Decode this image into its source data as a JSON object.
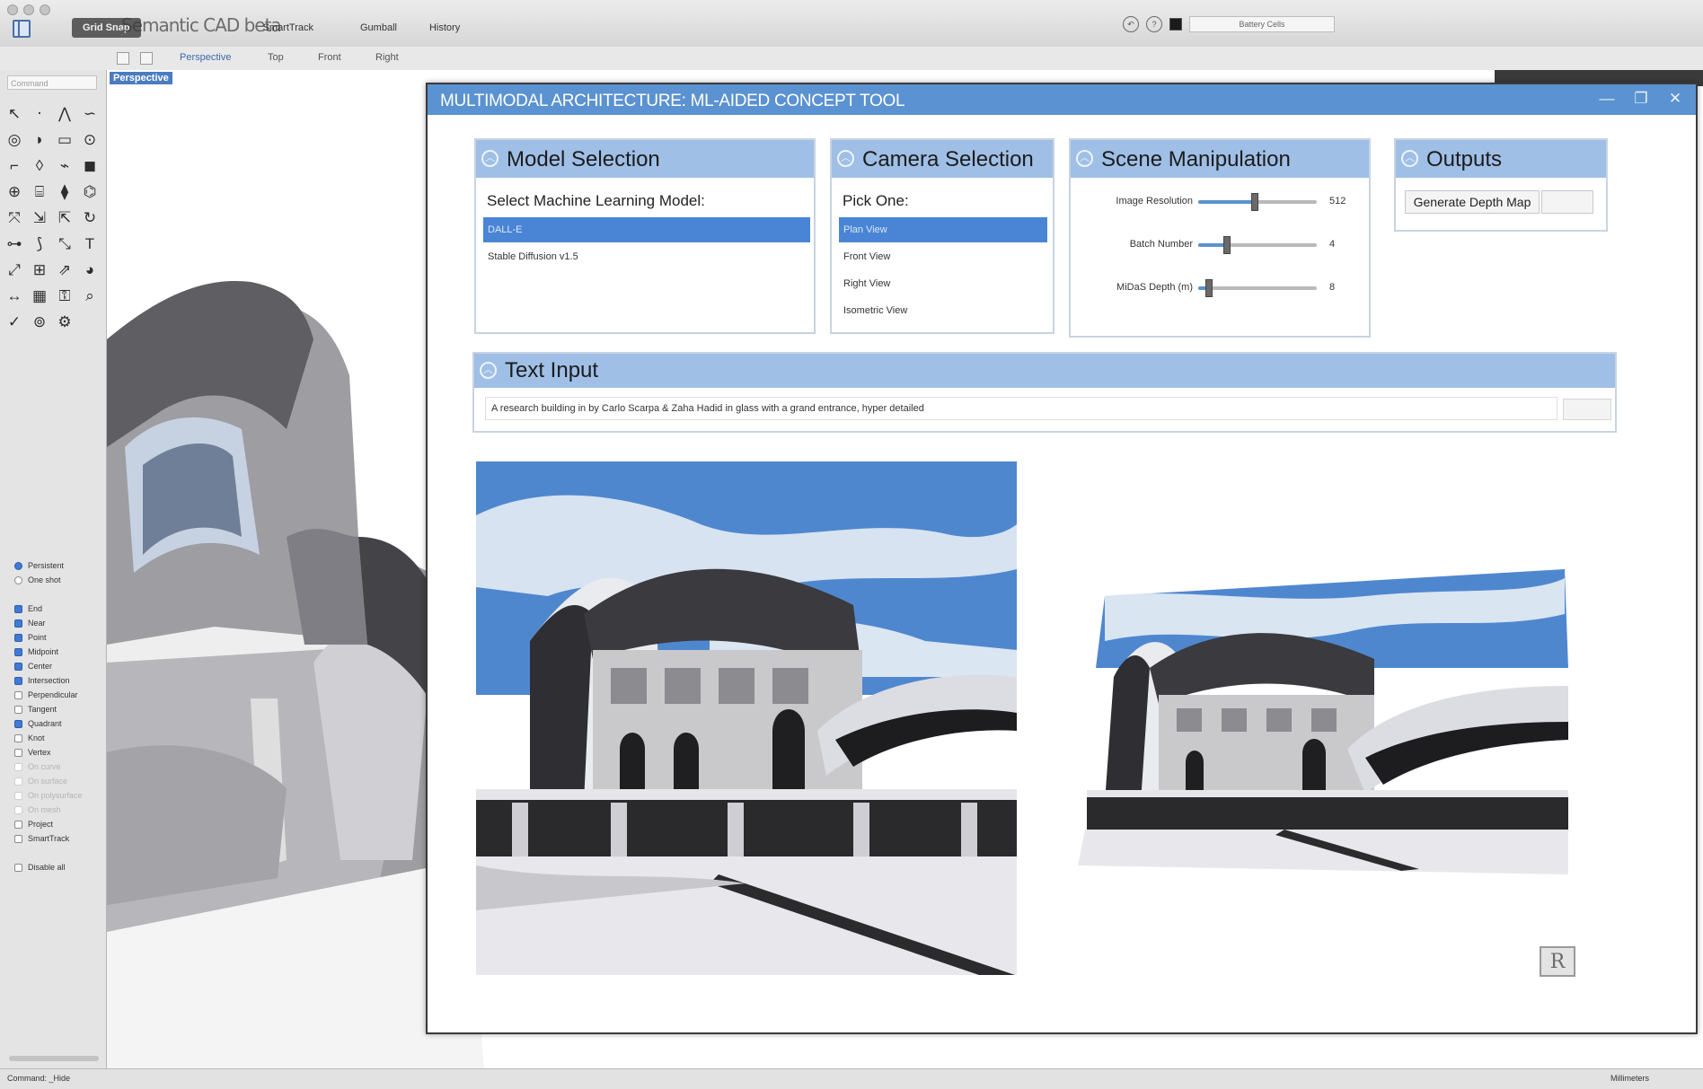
{
  "app": {
    "document_title": "Semantic CAD beta",
    "osnap_tabs": [
      "Grid Snap",
      "SmartTrack",
      "Gumball",
      "History"
    ],
    "layer_field": "Battery Cells",
    "command_placeholder": "Command",
    "viewport_tabs": [
      "Perspective",
      "Top",
      "Front",
      "Right"
    ],
    "active_viewport": "Perspective"
  },
  "osnaps": [
    {
      "label": "Persistent",
      "checked": true,
      "radio": true
    },
    {
      "label": "One shot",
      "checked": false,
      "radio": true
    },
    {
      "label": "",
      "spacer": true
    },
    {
      "label": "End",
      "checked": true
    },
    {
      "label": "Near",
      "checked": true
    },
    {
      "label": "Point",
      "checked": true
    },
    {
      "label": "Midpoint",
      "checked": true
    },
    {
      "label": "Center",
      "checked": true
    },
    {
      "label": "Intersection",
      "checked": true
    },
    {
      "label": "Perpendicular",
      "checked": false
    },
    {
      "label": "Tangent",
      "checked": false
    },
    {
      "label": "Quadrant",
      "checked": true
    },
    {
      "label": "Knot",
      "checked": false
    },
    {
      "label": "Vertex",
      "checked": false
    },
    {
      "label": "On curve",
      "checked": false,
      "dim": true
    },
    {
      "label": "On surface",
      "checked": false,
      "dim": true
    },
    {
      "label": "On polysurface",
      "checked": false,
      "dim": true
    },
    {
      "label": "On mesh",
      "checked": false,
      "dim": true
    },
    {
      "label": "Project",
      "checked": false
    },
    {
      "label": "SmartTrack",
      "checked": false
    },
    {
      "label": "",
      "spacer": true
    },
    {
      "label": "Disable all",
      "checked": false
    }
  ],
  "status": {
    "command_line": "Command: _Hide",
    "units": "Millimeters"
  },
  "plugin": {
    "title": "MULTIMODAL ARCHITECTURE: ML-AIDED CONCEPT TOOL",
    "controls": {
      "minimize": "—",
      "maximize": "❐",
      "close": "✕"
    },
    "model_selection": {
      "title": "Model Selection",
      "prompt": "Select Machine Learning Model:",
      "items": [
        "DALL-E",
        "Stable Diffusion v1.5"
      ],
      "selected": 0
    },
    "camera_selection": {
      "title": "Camera Selection",
      "prompt": "Pick One:",
      "items": [
        "Plan View",
        "Front View",
        "Right View",
        "Isometric View"
      ],
      "selected": 0
    },
    "scene_manipulation": {
      "title": "Scene Manipulation",
      "sliders": [
        {
          "label": "Image Resolution",
          "value": "512",
          "fraction": 0.48
        },
        {
          "label": "Batch Number",
          "value": "4",
          "fraction": 0.24
        },
        {
          "label": "MiDaS Depth (m)",
          "value": "8",
          "fraction": 0.09
        }
      ]
    },
    "outputs": {
      "title": "Outputs",
      "button": "Generate Depth Map"
    },
    "text_input": {
      "title": "Text Input",
      "value": "A research building in by Carlo Scarpa & Zaha Hadid in glass with a grand entrance, hyper detailed"
    },
    "logo_letter": "R"
  },
  "icons": {
    "chevron": "collapse-chevron-icon",
    "logo": "rhino-logo-icon"
  },
  "colors": {
    "title_bar": "#5b92d1",
    "group_header": "#9fbfe6",
    "selection": "#4a85d5",
    "viewport_label": "#4a7cc0"
  }
}
